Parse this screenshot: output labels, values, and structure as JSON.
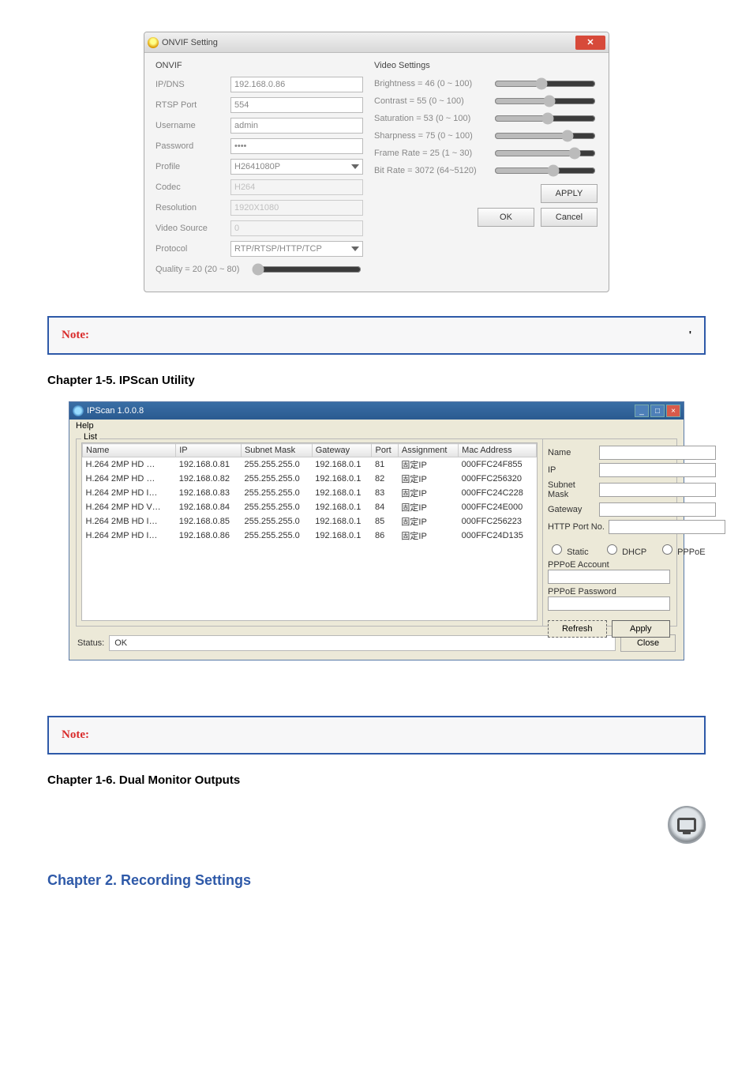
{
  "onvif": {
    "window_title": "ONVIF Setting",
    "close_label": "✕",
    "labels": {
      "section_left": "ONVIF",
      "ip": "IP/DNS",
      "rtsp": "RTSP Port",
      "user": "Username",
      "pass": "Password",
      "profile": "Profile",
      "codec": "Codec",
      "resolution": "Resolution",
      "video_source": "Video Source",
      "protocol": "Protocol",
      "quality": "Quality = 20 (20 ~ 80)",
      "section_right": "Video Settings",
      "brightness": "Brightness = 46 (0 ~ 100)",
      "contrast": "Contrast = 55 (0 ~ 100)",
      "saturation": "Saturation = 53 (0 ~ 100)",
      "sharpness": "Sharpness = 75 (0 ~ 100)",
      "framerate": "Frame Rate = 25 (1 ~ 30)",
      "bitrate": "Bit Rate = 3072 (64~5120)"
    },
    "values": {
      "ip": "192.168.0.86",
      "rtsp": "554",
      "user": "admin",
      "pass": "••••",
      "profile": "H2641080P",
      "codec": "H264",
      "resolution": "1920X1080",
      "video_source": "0",
      "protocol": "RTP/RTSP/HTTP/TCP",
      "brightness": 46,
      "contrast": 55,
      "saturation": 53,
      "sharpness": 75,
      "framerate": 25,
      "bitrate": 3072,
      "quality": 20
    },
    "buttons": {
      "apply": "APPLY",
      "ok": "OK",
      "cancel": "Cancel"
    }
  },
  "note1": {
    "label": "Note:",
    "body": "'"
  },
  "headings": {
    "sec1_5": "Chapter 1-5.   IPScan Utility",
    "sec1_6": "Chapter 1-6.   Dual Monitor Outputs",
    "sec2": "Chapter 2.   Recording Settings"
  },
  "ipscan": {
    "title": "IPScan 1.0.0.8",
    "menu_help": "Help",
    "list_legend": "List",
    "headers": [
      "Name",
      "IP",
      "Subnet Mask",
      "Gateway",
      "Port",
      "Assignment",
      "Mac Address"
    ],
    "rows": [
      {
        "name": "H.264 2MP HD …",
        "ip": "192.168.0.81",
        "mask": "255.255.255.0",
        "gw": "192.168.0.1",
        "port": "81",
        "assign": "固定IP",
        "mac": "000FFC24F855"
      },
      {
        "name": "H.264 2MP HD …",
        "ip": "192.168.0.82",
        "mask": "255.255.255.0",
        "gw": "192.168.0.1",
        "port": "82",
        "assign": "固定IP",
        "mac": "000FFC256320"
      },
      {
        "name": "H.264 2MP HD I…",
        "ip": "192.168.0.83",
        "mask": "255.255.255.0",
        "gw": "192.168.0.1",
        "port": "83",
        "assign": "固定IP",
        "mac": "000FFC24C228"
      },
      {
        "name": "H.264 2MP HD V…",
        "ip": "192.168.0.84",
        "mask": "255.255.255.0",
        "gw": "192.168.0.1",
        "port": "84",
        "assign": "固定IP",
        "mac": "000FFC24E000"
      },
      {
        "name": "H.264 2MB HD I…",
        "ip": "192.168.0.85",
        "mask": "255.255.255.0",
        "gw": "192.168.0.1",
        "port": "85",
        "assign": "固定IP",
        "mac": "000FFC256223"
      },
      {
        "name": "H.264 2MP HD I…",
        "ip": "192.168.0.86",
        "mask": "255.255.255.0",
        "gw": "192.168.0.1",
        "port": "86",
        "assign": "固定IP",
        "mac": "000FFC24D135"
      }
    ],
    "side": {
      "name": "Name",
      "ip": "IP",
      "mask": "Subnet Mask",
      "gw": "Gateway",
      "port": "HTTP Port No.",
      "r_static": "Static",
      "r_dhcp": "DHCP",
      "r_pppoe": "PPPoE",
      "pppoe_acct": "PPPoE Account",
      "pppoe_pwd": "PPPoE Password",
      "refresh": "Refresh",
      "apply": "Apply"
    },
    "status": {
      "label": "Status:",
      "value": "OK",
      "close": "Close"
    }
  },
  "note2": {
    "label": "Note:"
  }
}
